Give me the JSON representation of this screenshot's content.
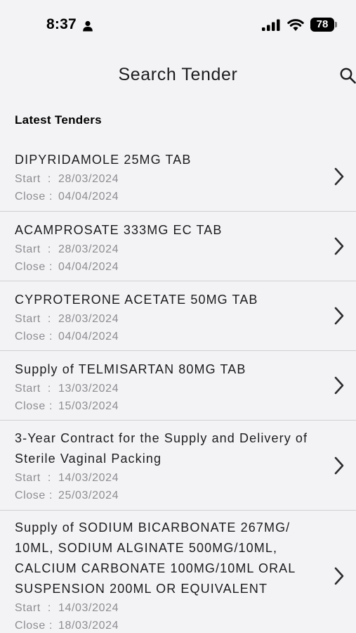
{
  "status_bar": {
    "time": "8:37",
    "battery": "78",
    "icons": [
      "person-icon",
      "signal-icon",
      "wifi-icon",
      "battery-icon"
    ]
  },
  "header": {
    "title": "Search Tender",
    "search_icon": "search-icon"
  },
  "section": {
    "title": "Latest Tenders"
  },
  "labels": {
    "start": "Start  :",
    "close": "Close :"
  },
  "tenders": [
    {
      "name": "DIPYRIDAMOLE 25MG TAB",
      "start": "28/03/2024",
      "close": "04/04/2024"
    },
    {
      "name": "ACAMPROSATE 333MG EC TAB",
      "start": "28/03/2024",
      "close": "04/04/2024"
    },
    {
      "name": "CYPROTERONE ACETATE 50MG TAB",
      "start": "28/03/2024",
      "close": "04/04/2024"
    },
    {
      "name": "Supply of TELMISARTAN 80MG TAB",
      "start": "13/03/2024",
      "close": "15/03/2024"
    },
    {
      "name": "3-Year Contract for the Supply and Delivery of Sterile Vaginal Packing",
      "start": "14/03/2024",
      "close": "25/03/2024"
    },
    {
      "name": "Supply of SODIUM BICARBONATE 267MG/ 10ML, SODIUM ALGINATE 500MG/10ML, CALCIUM CARBONATE 100MG/10ML ORAL SUSPENSION 200ML OR EQUIVALENT",
      "start": "14/03/2024",
      "close": "18/03/2024"
    }
  ]
}
